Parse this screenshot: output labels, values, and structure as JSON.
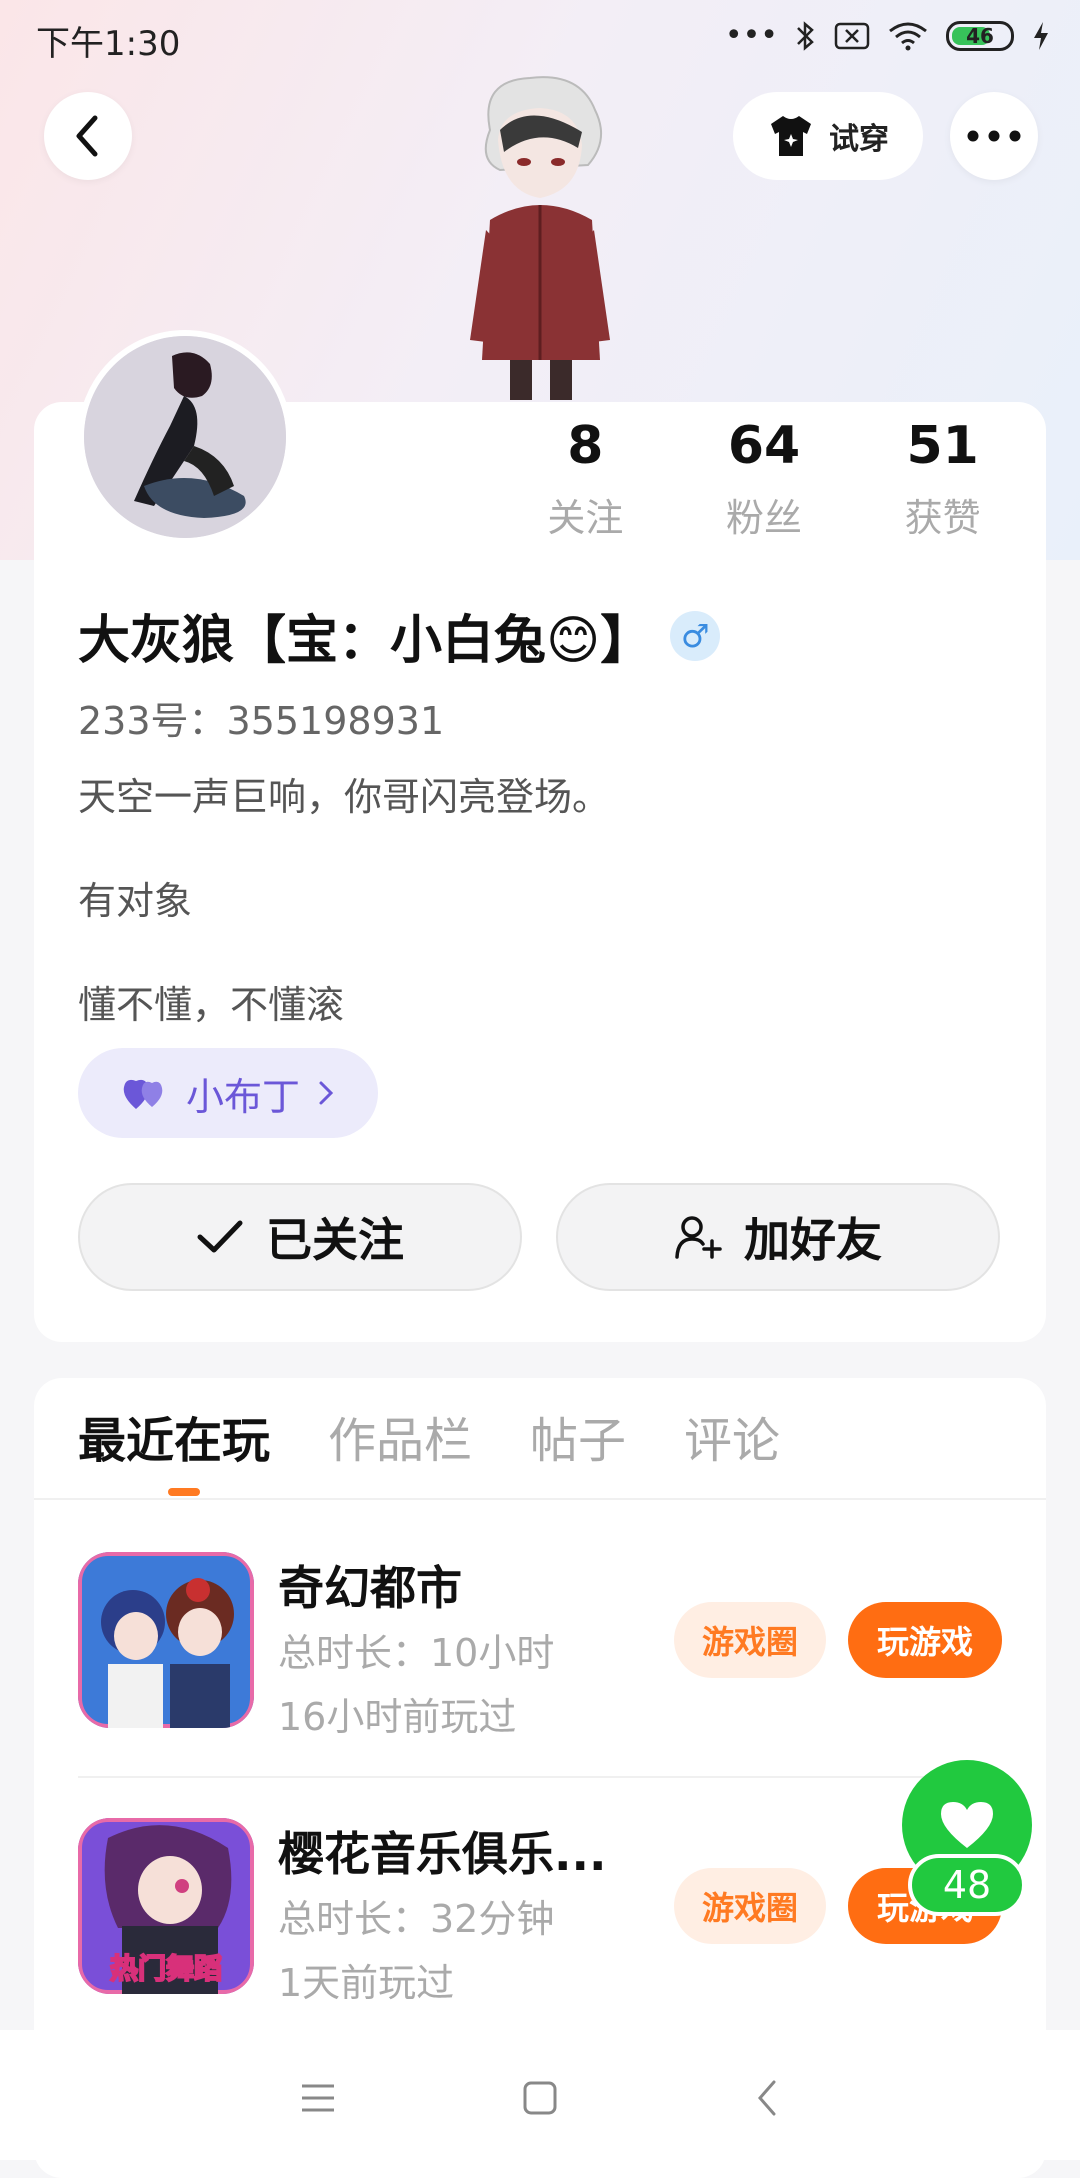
{
  "status_bar": {
    "time": "下午1:30",
    "battery": "46"
  },
  "header": {
    "try_on_label": "试穿"
  },
  "profile": {
    "stats": [
      {
        "value": "8",
        "label": "关注"
      },
      {
        "value": "64",
        "label": "粉丝"
      },
      {
        "value": "51",
        "label": "获赞"
      }
    ],
    "name": "大灰狼【宝：小白兔😊】",
    "gender_symbol": "♂",
    "id_text": "233号：355198931",
    "bio_lines": [
      "天空一声巨响，你哥闪亮登场。",
      "有对象",
      "懂不懂，不懂滚"
    ],
    "pet_label": "小布丁",
    "follow_label": "已关注",
    "add_friend_label": "加好友"
  },
  "tabs": [
    "最近在玩",
    "作品栏",
    "帖子",
    "评论"
  ],
  "games": [
    {
      "title": "奇幻都市",
      "duration": "总时长：10小时",
      "last_played": "16小时前玩过",
      "circle_label": "游戏圈",
      "play_label": "玩游戏"
    },
    {
      "title": "樱花音乐俱乐...",
      "duration": "总时长：32分钟",
      "last_played": "1天前玩过",
      "circle_label": "游戏圈",
      "play_label": "玩游戏",
      "icon_text": "热门舞蹈"
    }
  ],
  "like_count": "48",
  "colors": {
    "accent": "#ff6d12",
    "like_green": "#21c93f",
    "pet_purple": "#6b57d8"
  }
}
